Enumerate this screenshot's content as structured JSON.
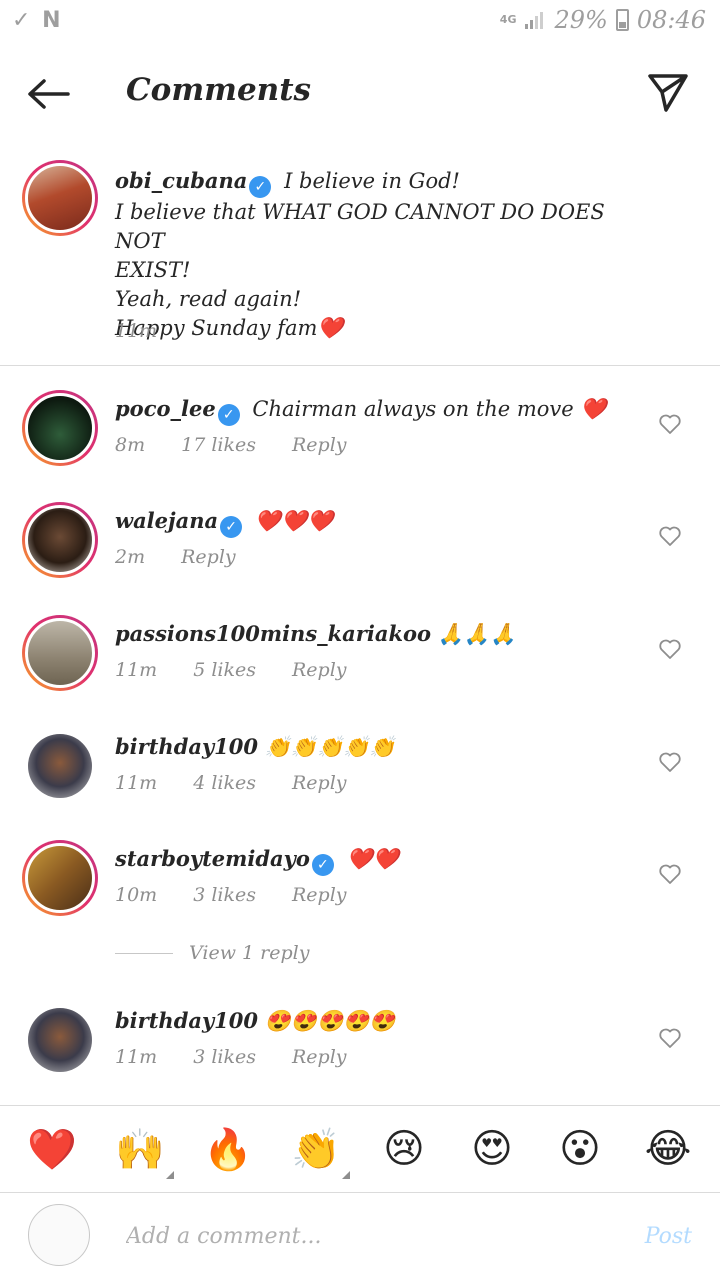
{
  "status_bar": {
    "left_icons": "✓ N",
    "network": "4G",
    "battery": "29%",
    "time": "08:46"
  },
  "header": {
    "title": "Comments"
  },
  "caption": {
    "username": "obi_cubana",
    "verified_mark": "✓",
    "lines": [
      "I believe in God!",
      "I believe that WHAT GOD CANNOT DO DOES NOT",
      "EXIST!",
      "Yeah, read again!",
      "Happy Sunday fam❤️"
    ],
    "time": "11m"
  },
  "comments": [
    {
      "username": "poco_lee",
      "verified": true,
      "text": "Chairman always on the move ❤️",
      "time": "8m",
      "likes": "17 likes",
      "reply": "Reply"
    },
    {
      "username": "walejana",
      "verified": true,
      "text": "❤️❤️❤️",
      "time": "2m",
      "likes": "",
      "reply": "Reply"
    },
    {
      "username": "passions100mins_kariakoo",
      "verified": false,
      "text": "🙏🙏🙏",
      "time": "11m",
      "likes": "5 likes",
      "reply": "Reply"
    },
    {
      "username": "birthday100",
      "verified": false,
      "text": "👏👏👏👏👏",
      "time": "11m",
      "likes": "4 likes",
      "reply": "Reply"
    },
    {
      "username": "starboytemidayo",
      "verified": true,
      "text": "❤️❤️",
      "time": "10m",
      "likes": "3 likes",
      "reply": "Reply"
    },
    {
      "username": "birthday100",
      "verified": false,
      "text": "😍😍😍😍😍",
      "time": "11m",
      "likes": "3 likes",
      "reply": "Reply"
    }
  ],
  "view_replies": "View 1 reply",
  "emoji_bar": [
    "❤️",
    "🙌",
    "🔥",
    "👏",
    "😢",
    "😍",
    "😮",
    "😂"
  ],
  "input": {
    "placeholder": "Add a comment...",
    "post_label": "Post"
  },
  "colors": {
    "accent": "#3897f0",
    "post_disabled": "#b3dbff",
    "muted": "#8e8e8e"
  }
}
